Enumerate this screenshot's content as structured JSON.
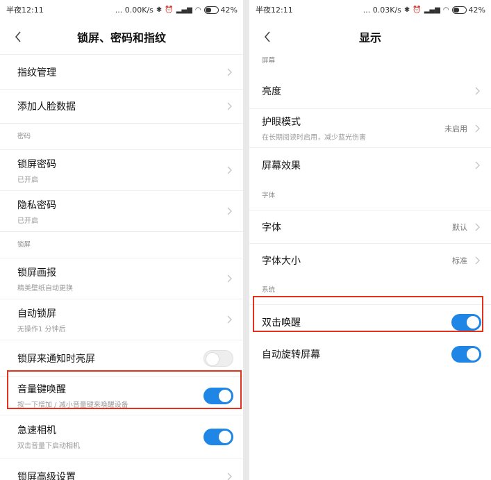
{
  "left": {
    "status": {
      "time": "半夜12:11",
      "speed": "... 0.00K/s",
      "battery": "42%"
    },
    "title": "锁屏、密码和指纹",
    "rows_top": [
      {
        "title": "指纹管理"
      },
      {
        "title": "添加人脸数据"
      }
    ],
    "section_password": "密码",
    "password_rows": [
      {
        "title": "锁屏密码",
        "sub": "已开启"
      },
      {
        "title": "隐私密码",
        "sub": "已开启"
      }
    ],
    "section_lock": "锁屏",
    "lock_rows": [
      {
        "title": "锁屏画报",
        "sub": "精美壁纸自动更换"
      },
      {
        "title": "自动锁屏",
        "sub": "无操作1 分钟后"
      },
      {
        "title": "锁屏来通知时亮屏",
        "toggle": false
      },
      {
        "title": "音量键唤醒",
        "sub": "按一下增加 / 减小音量键来唤醒设备",
        "toggle": true
      },
      {
        "title": "急速相机",
        "sub": "双击音量下启动相机",
        "toggle": true
      },
      {
        "title": "锁屏高级设置"
      }
    ]
  },
  "right": {
    "status": {
      "time": "半夜12:11",
      "speed": "... 0.03K/s",
      "battery": "42%"
    },
    "title": "显示",
    "section_screen": "屏幕",
    "screen_rows": [
      {
        "title": "亮度"
      },
      {
        "title": "护眼模式",
        "sub": "在长期阅读时启用，减少蓝光伤害",
        "value": "未启用"
      },
      {
        "title": "屏幕效果"
      }
    ],
    "section_font": "字体",
    "font_rows": [
      {
        "title": "字体",
        "value": "默认"
      },
      {
        "title": "字体大小",
        "value": "标准"
      }
    ],
    "section_system": "系统",
    "system_rows": [
      {
        "title": "双击唤醒",
        "toggle": true
      },
      {
        "title": "自动旋转屏幕",
        "toggle": true
      }
    ]
  },
  "colors": {
    "accent": "#1f86e6",
    "highlight": "#e2311d"
  },
  "icons": [
    "back-arrow-icon",
    "chevron-right-icon",
    "bluetooth-icon",
    "alarm-icon",
    "signal-icon",
    "wifi-icon",
    "battery-icon"
  ]
}
